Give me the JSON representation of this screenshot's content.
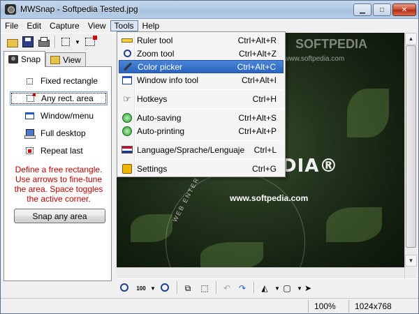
{
  "window": {
    "title": "MWSnap - Softpedia Tested.jpg"
  },
  "menubar": {
    "items": [
      "File",
      "Edit",
      "Capture",
      "View",
      "Tools",
      "Help"
    ]
  },
  "left_panel": {
    "tabs": [
      "Snap",
      "View"
    ],
    "options": [
      "Fixed rectangle",
      "Any rect. area",
      "Window/menu",
      "Full desktop",
      "Repeat last"
    ],
    "help_text": "Define a free rectangle. Use arrows to fine-tune the area. Space toggles the active corner.",
    "snap_button": "Snap any area"
  },
  "tools_menu": {
    "items": [
      {
        "label": "Ruler tool",
        "shortcut": "Ctrl+Alt+R",
        "icon": "ruler-icon"
      },
      {
        "label": "Zoom tool",
        "shortcut": "Ctrl+Alt+Z",
        "icon": "magnifier-icon"
      },
      {
        "label": "Color picker",
        "shortcut": "Ctrl+Alt+C",
        "icon": "eyedropper-icon"
      },
      {
        "label": "Window info tool",
        "shortcut": "Ctrl+Alt+I",
        "icon": "window-info-icon"
      },
      {
        "label": "Hotkeys",
        "shortcut": "Ctrl+H",
        "icon": "hand-icon"
      },
      {
        "label": "Auto-saving",
        "shortcut": "Ctrl+Alt+S",
        "icon": "auto-save-icon"
      },
      {
        "label": "Auto-printing",
        "shortcut": "Ctrl+Alt+P",
        "icon": "auto-print-icon"
      },
      {
        "label": "Language/Sprache/Lenguaje",
        "shortcut": "Ctrl+L",
        "icon": "flag-icon"
      },
      {
        "label": "Settings",
        "shortcut": "Ctrl+G",
        "icon": "settings-icon"
      }
    ]
  },
  "image": {
    "brand_text": "DIA®",
    "url_text": "www.softpedia.com",
    "arc_text": "WEB ENTERTAINMENT",
    "watermark": "SOFTPEDIA",
    "watermark_url": "www.softpedia.com"
  },
  "bottom_toolbar": {
    "zoom_100_label": "100"
  },
  "statusbar": {
    "zoom": "100%",
    "dimensions": "1024x768"
  },
  "colors": {
    "help_text": "#c00000",
    "menu_highlight": "#2a64c0"
  }
}
